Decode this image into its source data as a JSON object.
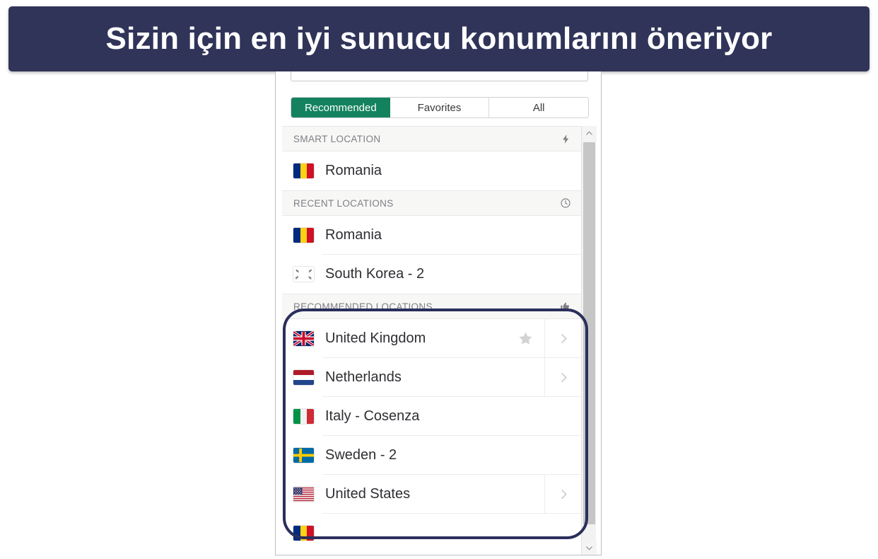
{
  "banner": {
    "text": "Sizin için en iyi sunucu konumlarını öneriyor",
    "background_color": "#303459",
    "text_color": "#ffffff"
  },
  "panel": {
    "search": {
      "value": "",
      "placeholder": ""
    },
    "tabs": [
      {
        "label": "Recommended",
        "active": true
      },
      {
        "label": "Favorites",
        "active": false
      },
      {
        "label": "All",
        "active": false
      }
    ],
    "accent_color": "#14825e",
    "highlight_color": "#2a2f5c",
    "sections": [
      {
        "id": "smart-location",
        "title": "SMART LOCATION",
        "icon": "lightning-bolt-icon",
        "rows": [
          {
            "label": "Romania",
            "flag": "romania-flag",
            "star": false,
            "chevron": false
          }
        ]
      },
      {
        "id": "recent-locations",
        "title": "RECENT LOCATIONS",
        "icon": "clock-icon",
        "rows": [
          {
            "label": "Romania",
            "flag": "romania-flag",
            "star": false,
            "chevron": false
          },
          {
            "label": "South Korea - 2",
            "flag": "south-korea-flag",
            "star": false,
            "chevron": false
          }
        ]
      },
      {
        "id": "recommended-locations",
        "title": "RECOMMENDED LOCATIONS",
        "icon": "thumbs-up-icon",
        "highlighted": true,
        "rows": [
          {
            "label": "United Kingdom",
            "flag": "united-kingdom-flag",
            "star": true,
            "chevron": true
          },
          {
            "label": "Netherlands",
            "flag": "netherlands-flag",
            "star": false,
            "chevron": true
          },
          {
            "label": "Italy - Cosenza",
            "flag": "italy-flag",
            "star": false,
            "chevron": false
          },
          {
            "label": "Sweden - 2",
            "flag": "sweden-flag",
            "star": false,
            "chevron": false
          },
          {
            "label": "United States",
            "flag": "united-states-flag",
            "star": false,
            "chevron": true
          }
        ]
      }
    ],
    "partial_row": {
      "label": "",
      "flag": "romania-flag"
    },
    "scrollbar": {
      "up_icon": "chevron-up-icon",
      "down_icon": "chevron-down-icon"
    }
  }
}
